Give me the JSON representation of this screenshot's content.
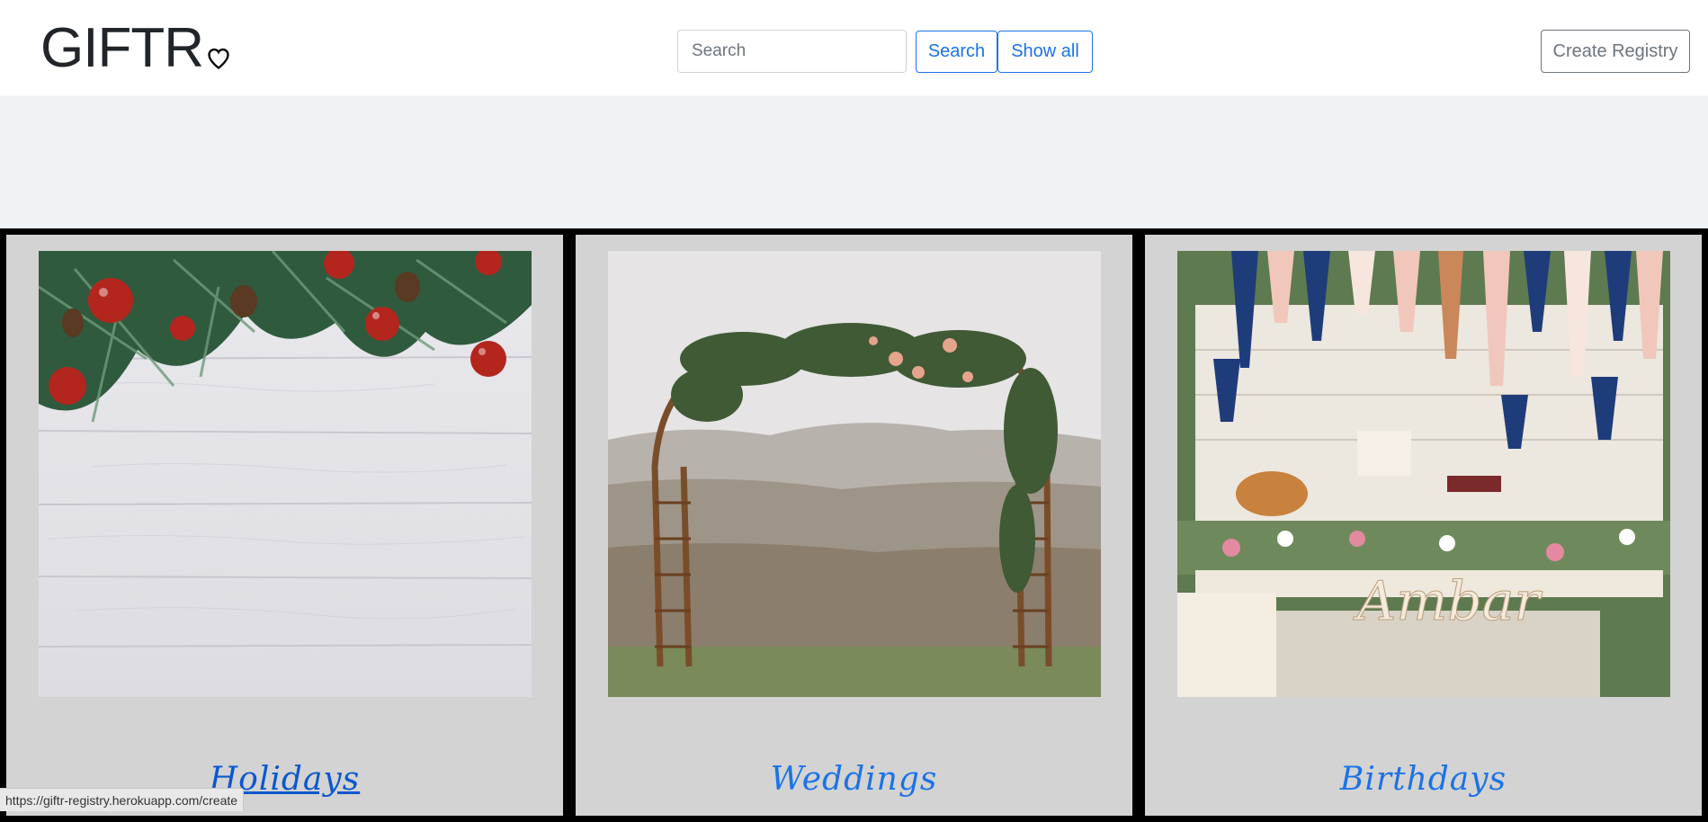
{
  "brand": {
    "name": "GIFTR",
    "icon": "heart-icon"
  },
  "search": {
    "placeholder": "Search",
    "value": "",
    "search_label": "Search",
    "show_all_label": "Show all"
  },
  "nav": {
    "create_label": "Create Registry"
  },
  "cards": [
    {
      "title": "Holidays",
      "image": "holiday-pine-ornaments-image"
    },
    {
      "title": "Weddings",
      "image": "wedding-arch-image"
    },
    {
      "title": "Birthdays",
      "image": "birthday-party-table-image"
    }
  ],
  "status": {
    "url": "https://giftr-registry.herokuapp.com/create"
  },
  "colors": {
    "primary": "#1a73e8",
    "secondary": "#6c757d",
    "card_bg": "#d3d3d3",
    "page_bg": "#f0f3f6"
  }
}
